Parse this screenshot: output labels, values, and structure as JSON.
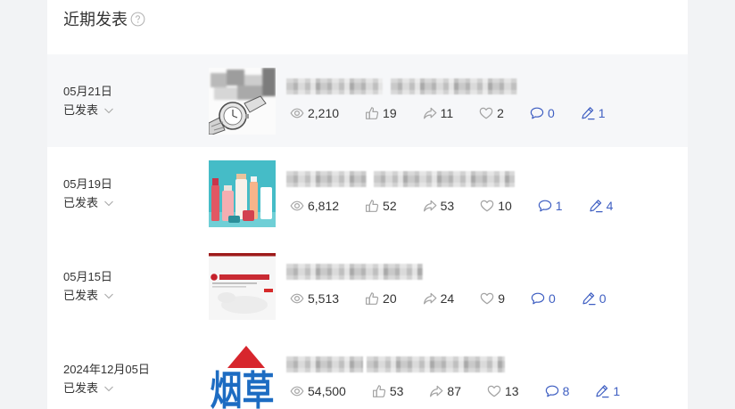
{
  "colors": {
    "page_bg": "#f2f3f5",
    "card_bg": "#ffffff",
    "highlight": "#f6f7f9",
    "text": "#333333",
    "icon": "#a3a3a3",
    "accent": "#3f5fc2"
  },
  "section": {
    "title": "近期发表",
    "help_icon": "question-circle-icon"
  },
  "stat_icons": [
    "eye-icon",
    "thumbs-up-icon",
    "share-icon",
    "heart-icon",
    "comment-icon",
    "edit-pen-icon"
  ],
  "rows": [
    {
      "date": "05月21日",
      "status": "已发表",
      "thumbnail": "watch-thumbnail",
      "highlighted": true,
      "stats": [
        "2,210",
        "19",
        "11",
        "2",
        "0",
        "1"
      ]
    },
    {
      "date": "05月19日",
      "status": "已发表",
      "thumbnail": "cosmetics-thumbnail",
      "stats": [
        "6,812",
        "52",
        "53",
        "10",
        "1",
        "4"
      ]
    },
    {
      "date": "05月15日",
      "status": "已发表",
      "thumbnail": "notice-document-thumbnail",
      "stats": [
        "5,513",
        "20",
        "24",
        "9",
        "0",
        "0"
      ]
    },
    {
      "date": "2024年12月05日",
      "status": "已发表",
      "thumbnail": "tobacco-thumbnail",
      "image_text": "烟草",
      "stats": [
        "54,500",
        "53",
        "87",
        "13",
        "8",
        "1"
      ]
    }
  ]
}
